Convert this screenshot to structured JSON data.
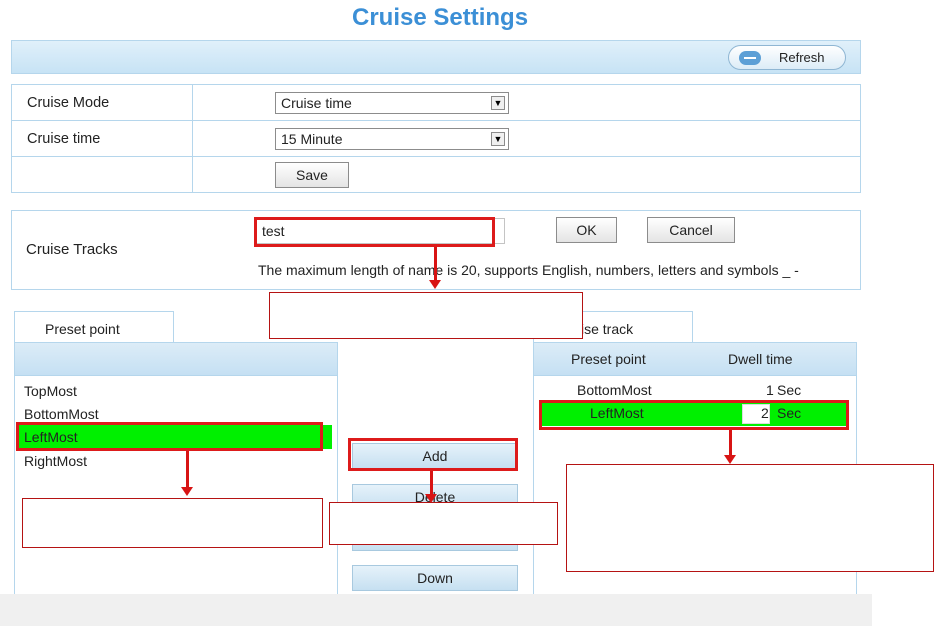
{
  "title": "Cruise Settings",
  "toolbar": {
    "refresh_label": "Refresh"
  },
  "form": {
    "cruise_mode_label": "Cruise Mode",
    "cruise_mode_value": "Cruise time",
    "cruise_time_label": "Cruise time",
    "cruise_time_value": "15 Minute",
    "save_label": "Save"
  },
  "tracks": {
    "label": "Cruise Tracks",
    "name_value": "test",
    "ok_label": "OK",
    "cancel_label": "Cancel",
    "hint": "The maximum length of name is 20, supports English, numbers, letters and symbols _ -"
  },
  "preset_panel": {
    "tab_label": "Preset point",
    "items": [
      "TopMost",
      "BottomMost",
      "LeftMost",
      "RightMost"
    ],
    "selected": "LeftMost"
  },
  "actions": {
    "add": "Add",
    "delete": "Delete",
    "down": "Down"
  },
  "track_panel": {
    "tab_label": "ise track",
    "col_preset": "Preset point",
    "col_dwell": "Dwell time",
    "rows": [
      {
        "preset": "BottomMost",
        "dwell": "1",
        "unit": "Sec"
      },
      {
        "preset": "LeftMost",
        "dwell": "2",
        "unit": "Sec"
      }
    ]
  },
  "colors": {
    "accent": "#3b8fd6",
    "highlight": "#00f000",
    "callout_red": "#dd1b1b"
  }
}
